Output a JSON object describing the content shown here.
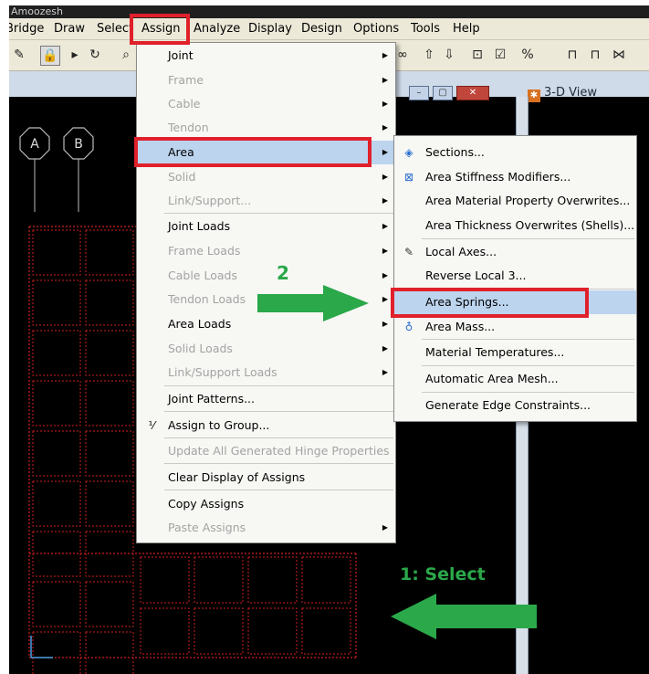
{
  "window": {
    "title": "Amoozesh"
  },
  "menubar": {
    "items": [
      "Bridge",
      "Draw",
      "Select",
      "Assign",
      "Analyze",
      "Display",
      "Design",
      "Options",
      "Tools",
      "Help"
    ]
  },
  "toolbar": {
    "icons": [
      "pencil-icon",
      "lock-icon",
      "play-icon",
      "rotate-icon",
      "zoom-icon"
    ]
  },
  "view_window": {
    "title": "3-D View",
    "grid_labels": [
      "A",
      "B"
    ]
  },
  "assign_menu": {
    "items": [
      {
        "label": "Joint",
        "enabled": true,
        "submenu": true
      },
      {
        "label": "Frame",
        "enabled": false,
        "submenu": true
      },
      {
        "label": "Cable",
        "enabled": false,
        "submenu": true
      },
      {
        "label": "Tendon",
        "enabled": false,
        "submenu": true
      },
      {
        "label": "Area",
        "enabled": true,
        "submenu": true,
        "highlighted": true
      },
      {
        "label": "Solid",
        "enabled": false,
        "submenu": true
      },
      {
        "label": "Link/Support...",
        "enabled": false,
        "submenu": true
      },
      {
        "label": "Joint Loads",
        "enabled": true,
        "submenu": true
      },
      {
        "label": "Frame Loads",
        "enabled": false,
        "submenu": true
      },
      {
        "label": "Cable Loads",
        "enabled": false,
        "submenu": true
      },
      {
        "label": "Tendon Loads",
        "enabled": false,
        "submenu": true
      },
      {
        "label": "Area Loads",
        "enabled": true,
        "submenu": true
      },
      {
        "label": "Solid Loads",
        "enabled": false,
        "submenu": true
      },
      {
        "label": "Link/Support Loads",
        "enabled": false,
        "submenu": true
      },
      {
        "label": "Joint Patterns...",
        "enabled": true,
        "submenu": false
      },
      {
        "label": "Assign to Group...",
        "enabled": true,
        "submenu": false
      },
      {
        "label": "Update All Generated Hinge Properties",
        "enabled": false,
        "submenu": false
      },
      {
        "label": "Clear Display of Assigns",
        "enabled": true,
        "submenu": false
      },
      {
        "label": "Copy Assigns",
        "enabled": true,
        "submenu": false
      },
      {
        "label": "Paste Assigns",
        "enabled": false,
        "submenu": true
      }
    ]
  },
  "area_submenu": {
    "items": [
      {
        "label": "Sections...",
        "icon": "sections-icon"
      },
      {
        "label": "Area Stiffness Modifiers...",
        "icon": "modifiers-icon"
      },
      {
        "label": "Area Material Property Overwrites...",
        "icon": ""
      },
      {
        "label": "Area Thickness Overwrites (Shells)...",
        "icon": ""
      },
      {
        "label": "Local Axes...",
        "icon": "local-axes-icon"
      },
      {
        "label": "Reverse Local 3...",
        "icon": ""
      },
      {
        "label": "Area Springs...",
        "icon": "",
        "highlighted": true
      },
      {
        "label": "Area Mass...",
        "icon": "area-mass-icon"
      },
      {
        "label": "Material Temperatures...",
        "icon": ""
      },
      {
        "label": "Automatic Area Mesh...",
        "icon": ""
      },
      {
        "label": "Generate Edge Constraints...",
        "icon": ""
      }
    ]
  },
  "annotations": {
    "step2": "2",
    "step1": "1: Select"
  },
  "colors": {
    "highlight": "#bcd4ee",
    "redbox": "#e0202a",
    "annotation_green": "#2aa84a",
    "grid_red": "#d02020"
  }
}
